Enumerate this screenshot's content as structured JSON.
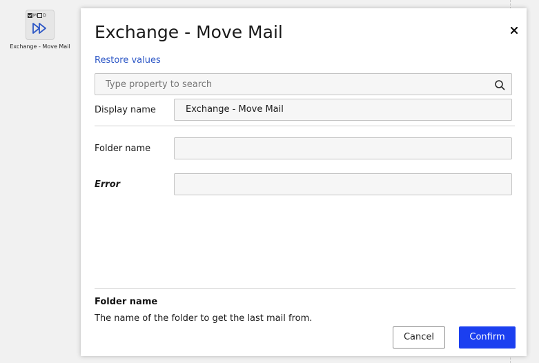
{
  "canvas": {
    "node": {
      "badges": [
        "M",
        "D"
      ],
      "label": "Exchange - Move Mail",
      "icon": "fast-forward-icon"
    }
  },
  "dialog": {
    "title": "Exchange - Move Mail",
    "restore_label": "Restore values",
    "search": {
      "placeholder": "Type property to search",
      "value": ""
    },
    "fields": {
      "display_name": {
        "label": "Display name",
        "value": "Exchange - Move Mail"
      },
      "folder_name": {
        "label": "Folder name",
        "value": ""
      },
      "error": {
        "label": "Error",
        "value": ""
      }
    },
    "help": {
      "title": "Folder name",
      "text": "The name of the folder to get the last mail from."
    },
    "buttons": {
      "cancel": "Cancel",
      "confirm": "Confirm"
    }
  },
  "colors": {
    "accent": "#1b3ff0",
    "link": "#2d57c6"
  }
}
